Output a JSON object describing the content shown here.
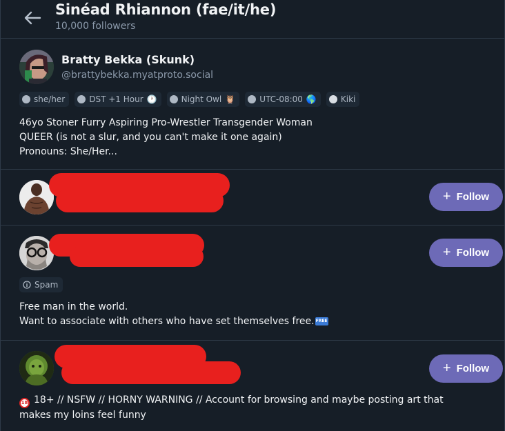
{
  "header": {
    "title": "Sinéad Rhiannon (fae/it/he)",
    "followers": "10,000 followers",
    "back_icon": "arrow-left-icon"
  },
  "profiles": [
    {
      "name": "Bratty Bekka (Skunk)",
      "handle": "@brattybekka.myatproto.social",
      "chips": [
        {
          "label": "she/her",
          "emoji": ""
        },
        {
          "label": "DST +1 Hour",
          "emoji": "🕐"
        },
        {
          "label": "Night Owl",
          "emoji": "🦉"
        },
        {
          "label": "UTC-08:00",
          "emoji": "🌎"
        },
        {
          "label": "Kiki",
          "emoji": ""
        }
      ],
      "bio": [
        "46yo Stoner Furry Aspiring Pro-Wrestler Transgender Woman",
        "QUEER (is not a slur, and you can't make it one again)",
        "Pronouns: She/Her..."
      ]
    },
    {
      "follow_label": "Follow"
    },
    {
      "follow_label": "Follow",
      "spam_label": "Spam",
      "bio": [
        "Free man in the world.",
        "Want to associate with others who have set themselves free."
      ],
      "free_badge": "FREE"
    },
    {
      "follow_label": "Follow",
      "age_badge": "18",
      "bio": [
        "18+ // NSFW // HORNY WARNING // Account for browsing and maybe posting art that",
        "makes my loins feel funny"
      ]
    }
  ],
  "colors": {
    "background": "#161e27",
    "follow_button": "#6d6ab7",
    "redaction": "#e8201e",
    "muted_text": "#8c9aab"
  }
}
